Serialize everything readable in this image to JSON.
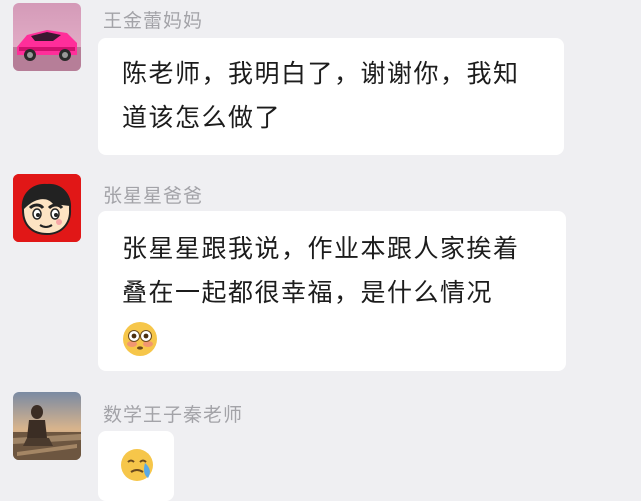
{
  "messages": [
    {
      "sender": "王金蕾妈妈",
      "avatar_icon": "pink-sports-car-avatar",
      "lines": [
        "陈老师，我明白了，谢谢你，我知",
        "道该怎么做了"
      ]
    },
    {
      "sender": "张星星爸爸",
      "avatar_icon": "cartoon-boy-red-avatar",
      "lines": [
        "张星星跟我说，作业本跟人家挨着",
        "叠在一起都很幸福，是什么情况"
      ],
      "emoji": "flushed-face-emoji"
    },
    {
      "sender": "数学王子秦老师",
      "avatar_icon": "beach-sunset-person-avatar",
      "emoji": "crying-face-emoji"
    }
  ],
  "colors": {
    "background": "#efeff2",
    "bubble": "#ffffff",
    "sender_name": "#a3a3a8",
    "text": "#1c1c1c"
  }
}
